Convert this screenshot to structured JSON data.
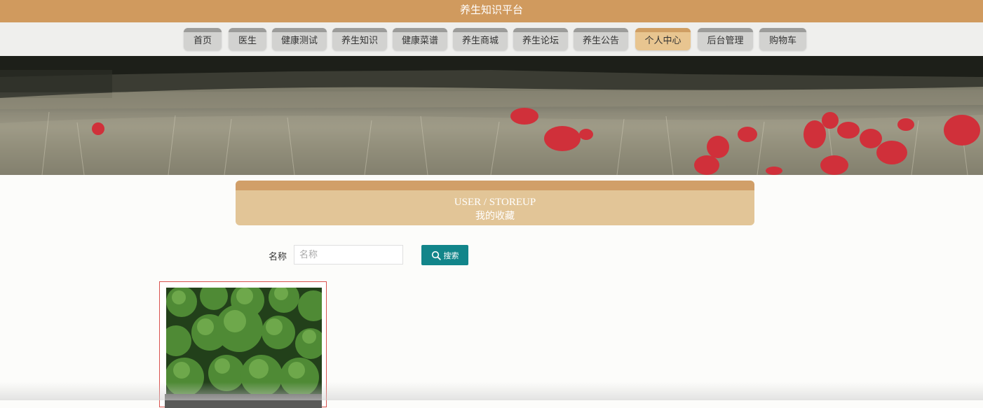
{
  "header": {
    "title": "养生知识平台"
  },
  "nav": {
    "items": [
      {
        "label": "首页"
      },
      {
        "label": "医生"
      },
      {
        "label": "健康测试"
      },
      {
        "label": "养生知识"
      },
      {
        "label": "健康菜谱"
      },
      {
        "label": "养生商城"
      },
      {
        "label": "养生论坛"
      },
      {
        "label": "养生公告"
      },
      {
        "label": "个人中心",
        "active": true
      },
      {
        "label": "后台管理"
      },
      {
        "label": "购物车"
      }
    ]
  },
  "section": {
    "title_en": "USER / STOREUP",
    "title_cn": "我的收藏"
  },
  "search": {
    "label": "名称",
    "placeholder": "名称",
    "value": "",
    "button_label": "搜索",
    "button_icon": "search-icon"
  },
  "favorites": [
    {
      "image": "broccoli-photo",
      "image_icon": "broccoli-image"
    }
  ],
  "colors": {
    "brand": "#d09a5e",
    "active_tab": "#e8c590",
    "search_button": "#12858a",
    "card_border": "#d9534f"
  }
}
